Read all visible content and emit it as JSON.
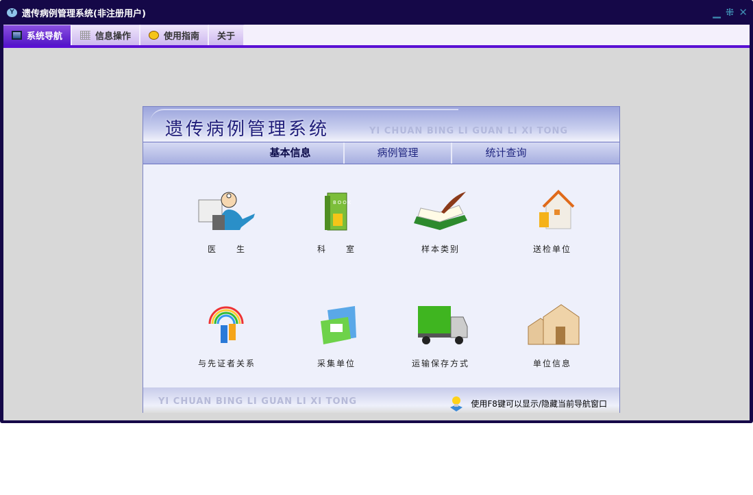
{
  "window": {
    "title": "遗传病例管理系统(非注册用户)",
    "logo": "Y",
    "controls": [
      "minimize",
      "restore",
      "close"
    ]
  },
  "tabs": [
    {
      "label": "系统导航",
      "icon": "monitor-icon",
      "active": true
    },
    {
      "label": "信息操作",
      "icon": "grid-icon"
    },
    {
      "label": "使用指南",
      "icon": "help-icon"
    },
    {
      "label": "关于"
    }
  ],
  "panel": {
    "title": "遗传病例管理系统",
    "subtitle": "YI CHUAN BING LI GUAN LI XI TONG",
    "nav": [
      "基本信息",
      "病例管理",
      "统计查询"
    ],
    "items": [
      {
        "label": "医　　生",
        "icon": "doctor-icon"
      },
      {
        "label": "科　　室",
        "icon": "book-icon"
      },
      {
        "label": "样本类别",
        "icon": "open-book-icon"
      },
      {
        "label": "送检单位",
        "icon": "house-icon"
      },
      {
        "label": "与先证者关系",
        "icon": "rainbow-people-icon"
      },
      {
        "label": "采集单位",
        "icon": "folder-icon"
      },
      {
        "label": "运输保存方式",
        "icon": "truck-icon"
      },
      {
        "label": "单位信息",
        "icon": "building-icon"
      }
    ],
    "footer_subtitle": "YI CHUAN BING LI GUAN LI XI TONG",
    "hint": "使用F8键可以显示/隐藏当前导航窗口"
  }
}
